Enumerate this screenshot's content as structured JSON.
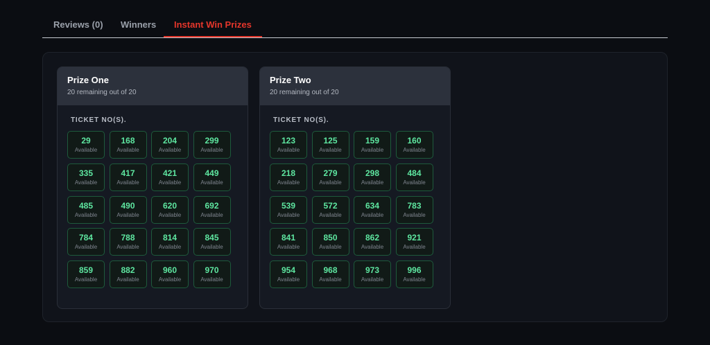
{
  "tabs": [
    {
      "label": "Reviews (0)",
      "active": false
    },
    {
      "label": "Winners",
      "active": false
    },
    {
      "label": "Instant Win Prizes",
      "active": true
    }
  ],
  "colors": {
    "accent": "#e5362b",
    "ticket_available": "#5ee6a0",
    "ticket_border": "#1e5a3c"
  },
  "prizes": [
    {
      "title": "Prize One",
      "remaining_text": "20 remaining out of 20",
      "ticket_label": "TICKET NO(S).",
      "tickets": [
        {
          "number": "29",
          "status": "Available"
        },
        {
          "number": "168",
          "status": "Available"
        },
        {
          "number": "204",
          "status": "Available"
        },
        {
          "number": "299",
          "status": "Available"
        },
        {
          "number": "335",
          "status": "Available"
        },
        {
          "number": "417",
          "status": "Available"
        },
        {
          "number": "421",
          "status": "Available"
        },
        {
          "number": "449",
          "status": "Available"
        },
        {
          "number": "485",
          "status": "Available"
        },
        {
          "number": "490",
          "status": "Available"
        },
        {
          "number": "620",
          "status": "Available"
        },
        {
          "number": "692",
          "status": "Available"
        },
        {
          "number": "784",
          "status": "Available"
        },
        {
          "number": "788",
          "status": "Available"
        },
        {
          "number": "814",
          "status": "Available"
        },
        {
          "number": "845",
          "status": "Available"
        },
        {
          "number": "859",
          "status": "Available"
        },
        {
          "number": "882",
          "status": "Available"
        },
        {
          "number": "960",
          "status": "Available"
        },
        {
          "number": "970",
          "status": "Available"
        }
      ]
    },
    {
      "title": "Prize Two",
      "remaining_text": "20 remaining out of 20",
      "ticket_label": "TICKET NO(S).",
      "tickets": [
        {
          "number": "123",
          "status": "Available"
        },
        {
          "number": "125",
          "status": "Available"
        },
        {
          "number": "159",
          "status": "Available"
        },
        {
          "number": "160",
          "status": "Available"
        },
        {
          "number": "218",
          "status": "Available"
        },
        {
          "number": "279",
          "status": "Available"
        },
        {
          "number": "298",
          "status": "Available"
        },
        {
          "number": "484",
          "status": "Available"
        },
        {
          "number": "539",
          "status": "Available"
        },
        {
          "number": "572",
          "status": "Available"
        },
        {
          "number": "634",
          "status": "Available"
        },
        {
          "number": "783",
          "status": "Available"
        },
        {
          "number": "841",
          "status": "Available"
        },
        {
          "number": "850",
          "status": "Available"
        },
        {
          "number": "862",
          "status": "Available"
        },
        {
          "number": "921",
          "status": "Available"
        },
        {
          "number": "954",
          "status": "Available"
        },
        {
          "number": "968",
          "status": "Available"
        },
        {
          "number": "973",
          "status": "Available"
        },
        {
          "number": "996",
          "status": "Available"
        }
      ]
    }
  ]
}
